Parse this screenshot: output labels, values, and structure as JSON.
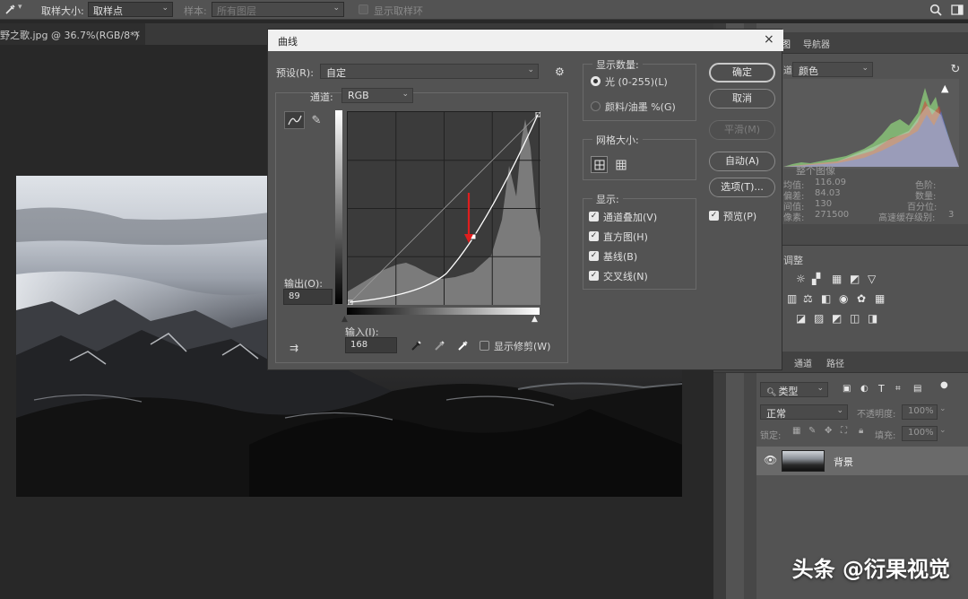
{
  "options_bar": {
    "sample_size_label": "取样大小:",
    "sample_size_value": "取样点",
    "sample_label": "样本:",
    "sample_value": "所有图层",
    "show_ring_label": "显示取样环"
  },
  "document_tab": {
    "title": "野之歌.jpg @ 36.7%(RGB/8*)",
    "close": "×"
  },
  "histogram_panel": {
    "tab_histogram": "图",
    "tab_navigator": "导航器",
    "channel": "颜色",
    "warning": "▲",
    "source": "整个图像",
    "stats_left": [
      {
        "label": "均值:",
        "value": "116.09"
      },
      {
        "label": "偏差:",
        "value": "84.03"
      },
      {
        "label": "间值:",
        "value": "130"
      },
      {
        "label": "像素:",
        "value": "271500"
      }
    ],
    "stats_right": [
      {
        "label": "色阶:",
        "value": ""
      },
      {
        "label": "数量:",
        "value": ""
      },
      {
        "label": "百分位:",
        "value": ""
      },
      {
        "label": "高速缓存级别:",
        "value": "3"
      }
    ]
  },
  "adjustments_panel": {
    "title": "调整"
  },
  "layers_panel": {
    "tab_channels": "通道",
    "tab_paths": "路径",
    "filter_kind": "类型",
    "blend_mode": "正常",
    "opacity_label": "不透明度:",
    "opacity_value": "100%",
    "lock_label": "锁定:",
    "fill_label": "填充:",
    "fill_value": "100%",
    "layer_name": "背景"
  },
  "curves_dialog": {
    "title": "曲线",
    "close": "×",
    "preset_label": "预设(R):",
    "preset_value": "自定",
    "channel_label": "通道:",
    "channel_value": "RGB",
    "output_label": "输出(O):",
    "output_value": "89",
    "input_label": "输入(I):",
    "input_value": "168",
    "show_clipping": "显示修剪(W)",
    "show_amount_title": "显示数量:",
    "light_option": "光 (0-255)(L)",
    "pigment_option": "颜料/油墨 %(G)",
    "grid_size_title": "网格大小:",
    "display_title": "显示:",
    "display_options": [
      "通道叠加(V)",
      "直方图(H)",
      "基线(B)",
      "交叉线(N)"
    ],
    "buttons": {
      "ok": "确定",
      "cancel": "取消",
      "smooth": "平滑(M)",
      "auto": "自动(A)",
      "options": "选项(T)..."
    },
    "preview_label": "预览(P)"
  },
  "watermark": "头条 @衍果视觉"
}
